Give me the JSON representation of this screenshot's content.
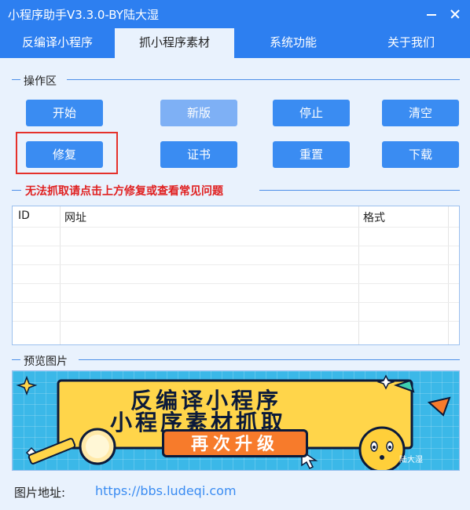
{
  "window": {
    "title": "小程序助手V3.3.0-BY陆大湿"
  },
  "tabs": [
    {
      "label": "反编译小程序"
    },
    {
      "label": "抓小程序素材"
    },
    {
      "label": "系统功能"
    },
    {
      "label": "关于我们"
    }
  ],
  "active_tab": "抓小程序素材",
  "ops": {
    "group_title": "操作区",
    "buttons": {
      "start": "开始",
      "new_version": "新版",
      "stop": "停止",
      "clear": "清空",
      "repair": "修复",
      "certificate": "证书",
      "reset": "重置",
      "download": "下载"
    }
  },
  "warning": "无法抓取请点击上方修复或查看常见问题",
  "table": {
    "columns": [
      "ID",
      "网址",
      "格式"
    ],
    "rows": []
  },
  "preview": {
    "group_title": "预览图片",
    "banner": {
      "line1": "反编译小程序",
      "line2": "小程序素材抓取",
      "button": "再次升级",
      "watermark": "陆大湿"
    }
  },
  "image_address": {
    "label": "图片地址:",
    "link": "https://bbs.ludeqi.com"
  },
  "colors": {
    "primary": "#2d7ff0",
    "button": "#3a8cf2",
    "warning": "#e02020",
    "background": "#e9f2fd"
  }
}
